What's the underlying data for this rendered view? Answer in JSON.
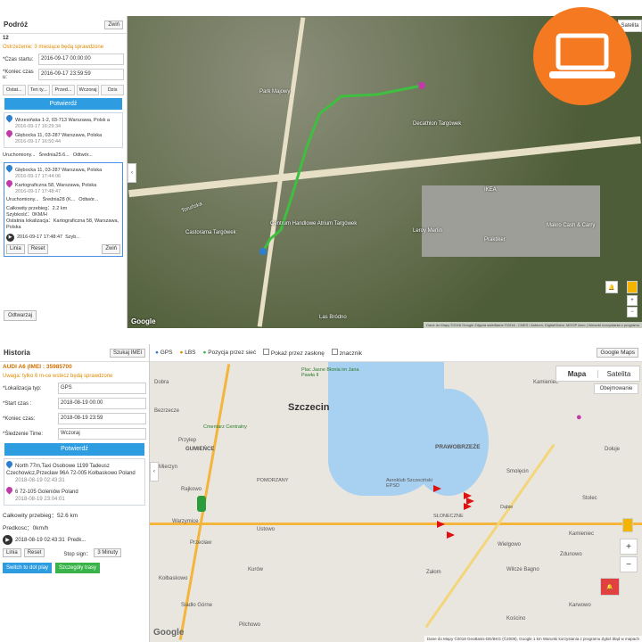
{
  "top": {
    "title": "Podróż",
    "collapse": "Zwiń",
    "id": "12",
    "warning": "Ostrzeżenie: 3 miesiące będą sprawdzone",
    "start_label": "*Czas startu:",
    "start_value": "2016-09-17 00:00:00",
    "end_label": "*Koniec czas u:",
    "end_value": "2016-09-17 23:59:59",
    "quick": [
      "Ostat...",
      "Ten ty...",
      "Przed...",
      "Wczoraj",
      "Dzis"
    ],
    "search": "Potwierdź",
    "card1": {
      "from": "Wrzesińska 1-2, 03-713 Warszawa, Polsk a",
      "from_time": "2016-09-17 16:29:34",
      "to": "Głębocka 11, 03-287 Warszawa, Polska",
      "to_time": "2016-09-17 16:50:44",
      "status": "Uruchomiony...",
      "speed": "Średnia25.6...",
      "open": "Odtwór..."
    },
    "card2": {
      "from": "Głębocka 11, 03-287 Warszawa, Polska",
      "from_time": "2016-09-17 17:44:06",
      "to": "Kartograficzna 58, Warszawa, Polska",
      "to_time": "2016-09-17 17:48:47",
      "status": "Uruchomiony...",
      "speed": "Średnia28 (K...",
      "open": "Odtwór...",
      "dist": "Całkowity przebieg：2.2 km",
      "spd": "Szybkość：0KM/H",
      "last": "Ostatnia lokalizacja：Kartograficzna 58, Warszawa, Polska",
      "play_time": "2016-09-17 17:48:47",
      "play_spd": "Szyb...",
      "btn1": "Linia",
      "btn2": "Reset",
      "btn3": "Zwiń"
    },
    "open_btn": "Odtwarzaj",
    "map_type": "Satelita",
    "labels": [
      "Park Majowy",
      "Decathlon Targówek",
      "IKEA",
      "Centrum Handlowe Atrium Targówek",
      "Castorama Targówek",
      "Leroy Merlin",
      "Praktiker",
      "Makro Cash & Carry",
      "Las Bródno",
      "Toruńska"
    ],
    "footer": "Dane do Mapy ©2016 Google Zdjęcia satelitarne ©2016 , CNES / Astrium, DigitalGlobe, MGGP Aero | Warunki korzystania z programu",
    "google": "Google"
  },
  "bottom": {
    "title": "Historia",
    "search_imei": "Szukaj IMEI",
    "device": "AUDI A6   (IMEI : 35985700",
    "warning": "Uwaga: tylko 6 m-ce wstecz będą sprawdzone",
    "loc_label": "*Lokalizacja typ:",
    "loc_value": "GPS",
    "start_label": "*Start czas :",
    "start_value": "2018-08-19 00:00",
    "end_label": "*Koniec czas:",
    "end_value": "2018-08-19 23:59",
    "time_label": "*Śledzenie Time:",
    "time_value": "Wczoraj",
    "search": "Potwierdź",
    "from": "North 77m,Taxi Osobowe 1199 Tadeusz Czechowicz,Przecław 96A 72-005 Kołbaskowo Poland",
    "from_time": "2018-08-19 02:43:31",
    "to": "6 72-105 Goleniów Poland",
    "to_time": "2018-08-19 23:04:01",
    "dist": "Całkowity przebieg：52.6 km",
    "spd": "Predkosc：0km/h",
    "play_time": "2018-08-19 02:43:31",
    "play_spd": "Predk...",
    "btn1": "Linia",
    "btn2": "Reset",
    "stop_label": "Stop sign：",
    "stop_value": "3 Minuty",
    "switch": "Switch to dot play",
    "details": "Szczegóły trasy",
    "legend": [
      "GPS",
      "LBS",
      "Pozycja przez sieć",
      "Pokaż przez zasłonę",
      "znacznik"
    ],
    "map_select": "Google Maps",
    "map_tab1": "Mapa",
    "map_tab2": "Satelita",
    "terrain": "Obejmowanie",
    "city": "Szczecin",
    "places": [
      "Plac Jasne Błonia im Jana Pawła II",
      "Cmentarz Centralny",
      "GUMIEŃCE",
      "POMORZANY",
      "PRAWOBRZEŻE",
      "Aeroklub Szczeciński EPSD",
      "SŁONECZNE",
      "Dąbie",
      "Przecław",
      "Ustowo",
      "Warzymice",
      "Rajkowo",
      "Przylep",
      "Bezrzecze",
      "Kołbaskowo",
      "Siadło Górne",
      "Kamieniec",
      "Zdunowo",
      "Wielgowo",
      "Załom",
      "Wilcze Bagno",
      "Kurów",
      "Dobra",
      "Mierzyn",
      "Kościno",
      "Karwowo",
      "Stolec",
      "Smolęcin",
      "Kamieniec",
      "Pilchowo",
      "Dołuje"
    ],
    "footer": "Dane do Mapy ©2018 GeoBasis-DE/BKG (©2009), Google   1 km         Warunki korzystania z programu   Zgłoś błąd w mapach",
    "google": "Google"
  }
}
